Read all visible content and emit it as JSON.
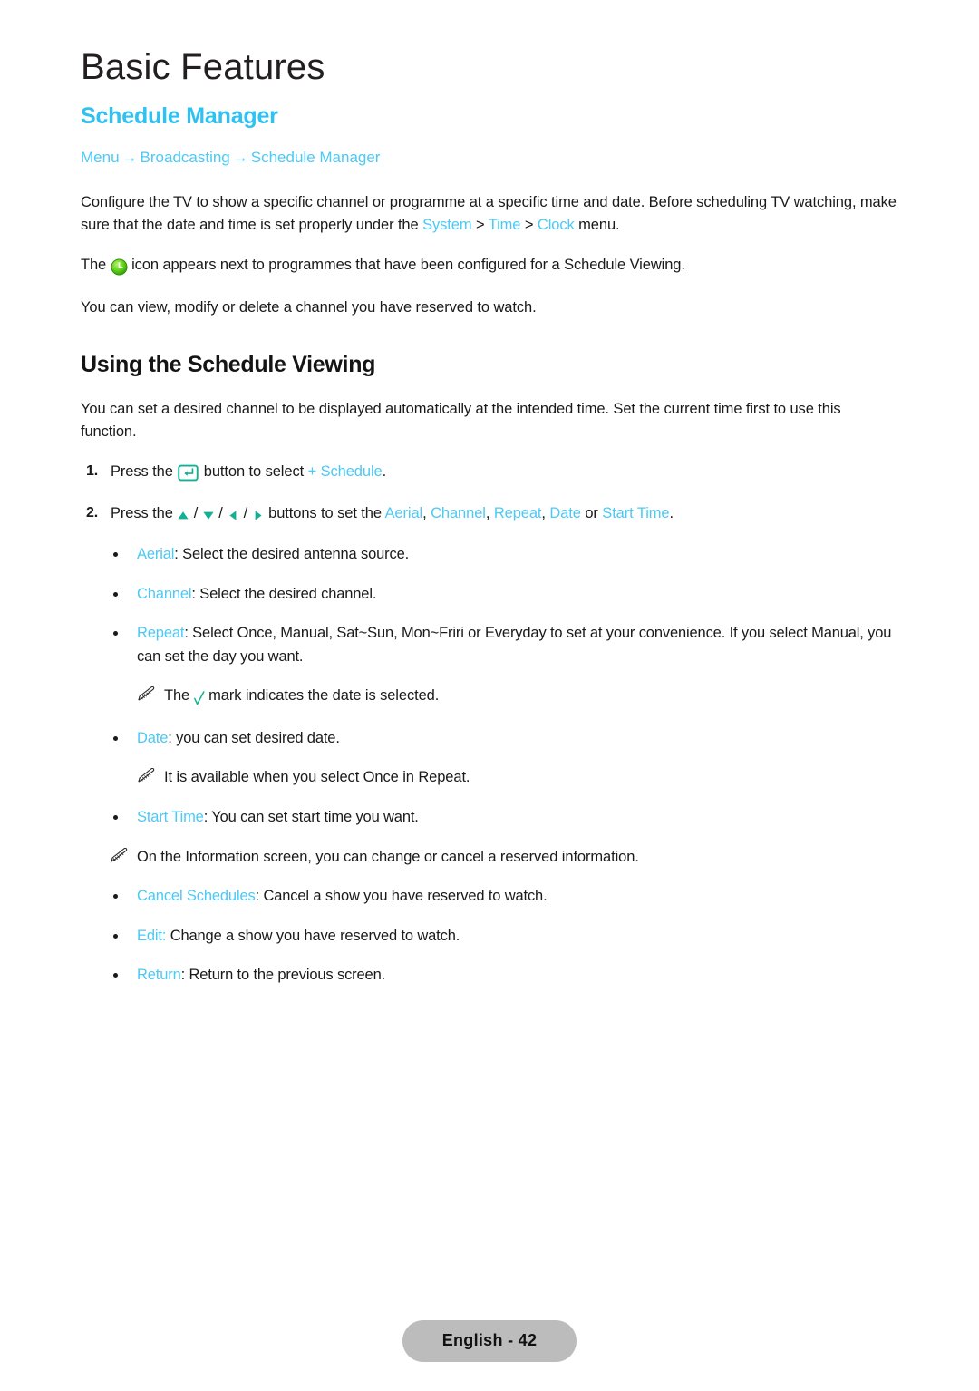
{
  "page": {
    "chapter_title": "Basic Features",
    "section_title": "Schedule Manager",
    "footer_badge": "English - 42",
    "colors": {
      "link_blue": "#4CC9F5",
      "heading_blue": "#2EC1F2",
      "accent_teal": "#13B193",
      "body_text": "#1a1a1a",
      "badge_bg": "#bcbcbc"
    }
  },
  "breadcrumb": {
    "items": [
      "Menu",
      "Broadcasting",
      "Schedule Manager"
    ],
    "separator": "→"
  },
  "intro": {
    "para1_a": "Configure the TV to show a specific channel or programme at a specific time and date. Before scheduling TV watching, make sure that the date and time is set properly under the ",
    "para1_link1": "System",
    "para1_sep1": " > ",
    "para1_link2": "Time",
    "para1_sep2": " > ",
    "para1_link3": "Clock",
    "para1_b": " menu.",
    "para2_a": "The ",
    "para2_icon": "clock-icon",
    "para2_b": " icon appears next to programmes that have been configured for a Schedule Viewing.",
    "para3": "You can view, modify or delete a channel you have reserved to watch."
  },
  "subsection": {
    "title": "Using the Schedule Viewing",
    "intro": "You can set a desired channel to be displayed automatically at the intended time. Set the current time first to use this function."
  },
  "steps": [
    {
      "num": "1.",
      "text_a": "Press the ",
      "icon": "enter-button-icon",
      "text_b": " button to select ",
      "link": "+ Schedule",
      "text_c": "."
    },
    {
      "num": "2.",
      "text_a": "Press the ",
      "icons": [
        "up-arrow-icon",
        "down-arrow-icon",
        "left-arrow-icon",
        "right-arrow-icon"
      ],
      "separator": " / ",
      "text_b": " buttons to set the ",
      "links": [
        "Aerial",
        "Channel",
        "Repeat",
        "Date",
        "Start Time"
      ],
      "link_join1": ", ",
      "link_join2": " or ",
      "text_c": "."
    }
  ],
  "bullets": [
    {
      "term": "Aerial",
      "desc": ": Select the desired antenna source."
    },
    {
      "term": "Channel",
      "desc": ": Select the desired channel."
    },
    {
      "term": "Repeat",
      "desc": ": Select Once, Manual, Sat~Sun, Mon~Friri or Everyday to set at your convenience. If you select Manual, you can set the day you want."
    },
    {
      "term": "Date",
      "desc": ": you can set desired date."
    },
    {
      "term": "Start Time",
      "desc": ": You can set start time you want."
    }
  ],
  "notes": {
    "repeat_note_a": "The ",
    "repeat_note_icon": "check-mark-icon",
    "repeat_note_b": " mark indicates the date is selected.",
    "date_note": "It is available when you select Once in Repeat.",
    "info_note": "On the Information screen, you can change or cancel a reserved information."
  },
  "final_bullets": [
    {
      "term": "Cancel Schedules",
      "colon_blue": false,
      "desc": ": Cancel a show you have reserved to watch."
    },
    {
      "term": "Edit:",
      "colon_blue": true,
      "desc": " Change a show you have reserved to watch."
    },
    {
      "term": "Return",
      "colon_blue": false,
      "desc": ": Return to the previous screen."
    }
  ]
}
